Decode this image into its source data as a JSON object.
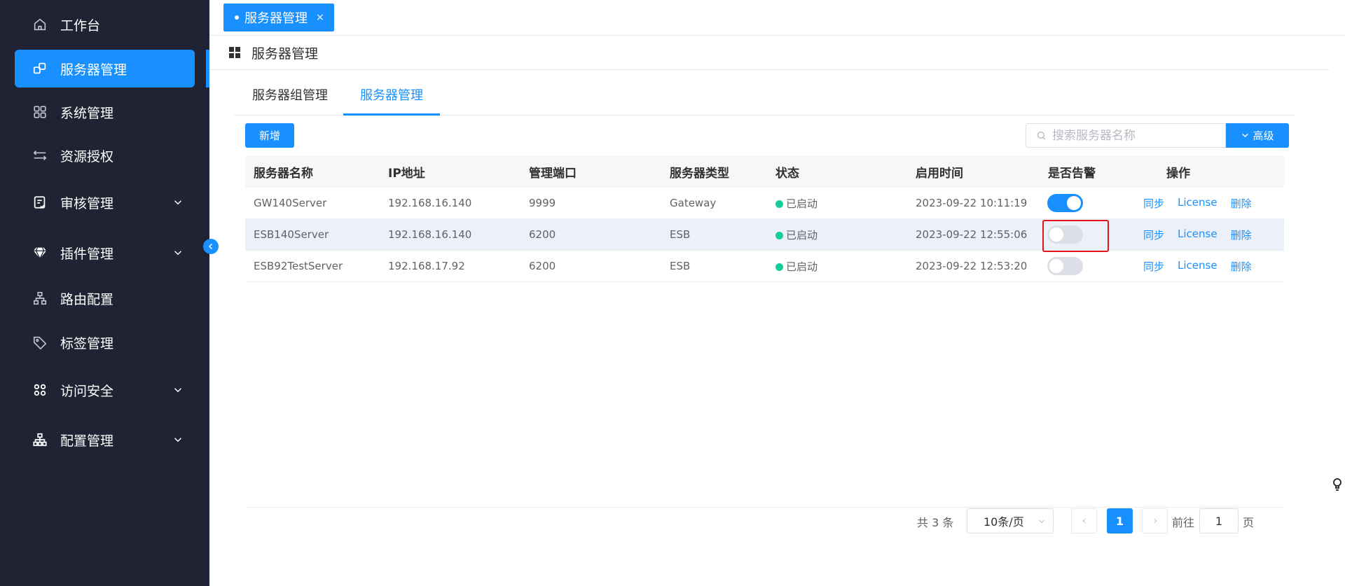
{
  "sidebar": {
    "items": [
      {
        "label": "工作台",
        "icon": "home-icon"
      },
      {
        "label": "服务器管理",
        "icon": "server-link-icon",
        "active": true
      },
      {
        "label": "系统管理",
        "icon": "grid-apps-icon"
      },
      {
        "label": "资源授权",
        "icon": "swap-arrows-icon"
      },
      {
        "label": "审核管理",
        "icon": "audit-doc-icon",
        "expandable": true
      },
      {
        "label": "插件管理",
        "icon": "diamond-icon",
        "expandable": true
      },
      {
        "label": "路由配置",
        "icon": "route-tree-icon"
      },
      {
        "label": "标签管理",
        "icon": "tag-icon"
      },
      {
        "label": "访问安全",
        "icon": "security-grid-icon",
        "expandable": true
      },
      {
        "label": "配置管理",
        "icon": "org-chart-icon",
        "expandable": true
      }
    ]
  },
  "tabbar": {
    "tab_label": "服务器管理",
    "close_glyph": "×"
  },
  "page": {
    "title": "服务器管理"
  },
  "inner_tabs": [
    {
      "label": "服务器组管理"
    },
    {
      "label": "服务器管理",
      "active": true
    }
  ],
  "toolbar": {
    "add_label": "新增",
    "search_placeholder": "搜索服务器名称",
    "advanced_label": "高级"
  },
  "table": {
    "headers": [
      "服务器名称",
      "IP地址",
      "管理端口",
      "服务器类型",
      "状态",
      "启用时间",
      "是否告警",
      "操作"
    ],
    "rows": [
      {
        "name": "GW140Server",
        "ip": "192.168.16.140",
        "port": "9999",
        "type": "Gateway",
        "status": "已启动",
        "time": "2023-09-22 10:11:19",
        "alarm": true
      },
      {
        "name": "ESB140Server",
        "ip": "192.168.16.140",
        "port": "6200",
        "type": "ESB",
        "status": "已启动",
        "time": "2023-09-22 12:55:06",
        "alarm": false
      },
      {
        "name": "ESB92TestServer",
        "ip": "192.168.17.92",
        "port": "6200",
        "type": "ESB",
        "status": "已启动",
        "time": "2023-09-22 12:53:20",
        "alarm": false
      }
    ],
    "actions": {
      "sync": "同步",
      "license": "License",
      "delete": "删除"
    }
  },
  "pagination": {
    "total": "共 3 条",
    "page_size": "10条/页",
    "current_page": "1",
    "goto_label": "前往",
    "goto_value": "1",
    "page_suffix": "页"
  },
  "colors": {
    "sidebar_bg": "#1f2333",
    "accent": "#1890ff",
    "status_green": "#13ce9b",
    "highlight_red": "#e5141b"
  }
}
